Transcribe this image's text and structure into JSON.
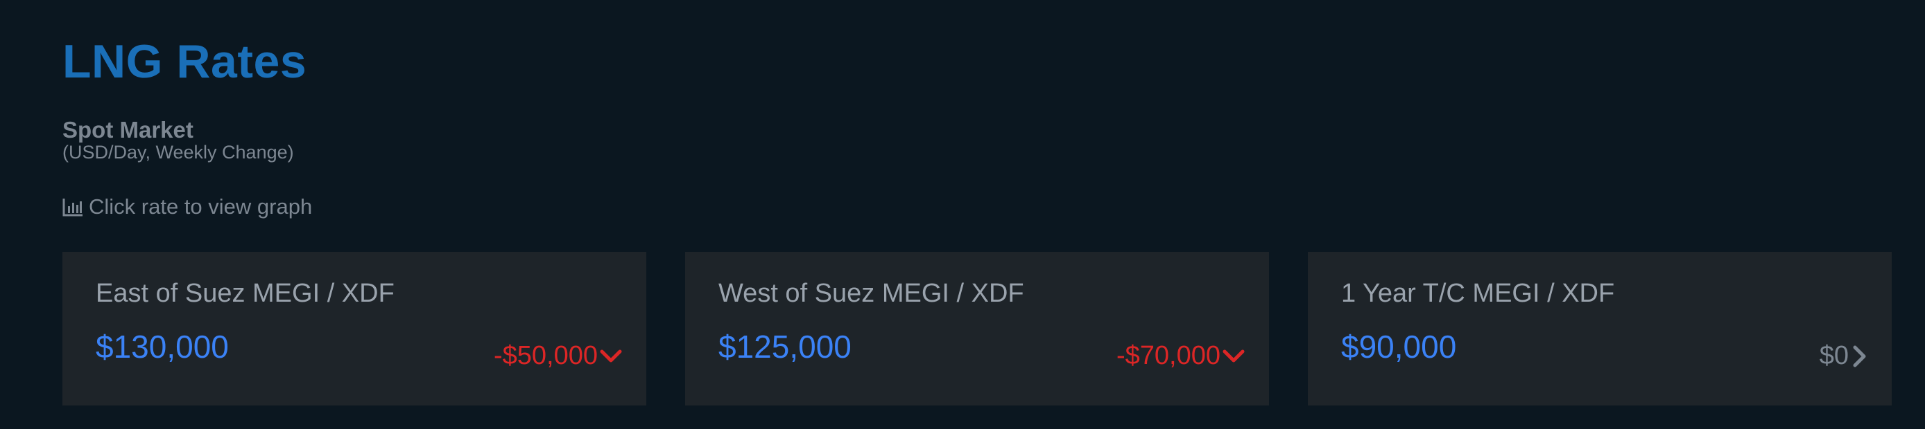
{
  "header": {
    "title": "LNG Rates",
    "subtitle": "Spot Market",
    "units": "(USD/Day, Weekly Change)",
    "hint": "Click rate to view graph",
    "hint_icon": "bar-chart-icon"
  },
  "colors": {
    "background": "#0b1720",
    "card_background": "#1e2429",
    "title": "#1a6fb8",
    "value": "#3b82f6",
    "negative": "#dc2626",
    "neutral": "#7d8792"
  },
  "cards": [
    {
      "label": "East of Suez MEGI / XDF",
      "value": "$130,000",
      "change": "-$50,000",
      "direction": "down",
      "icon": "chevron-down-icon"
    },
    {
      "label": "West of Suez MEGI / XDF",
      "value": "$125,000",
      "change": "-$70,000",
      "direction": "down",
      "icon": "chevron-down-icon"
    },
    {
      "label": "1 Year T/C MEGI / XDF",
      "value": "$90,000",
      "change": "$0",
      "direction": "flat",
      "icon": "chevron-right-icon"
    }
  ]
}
